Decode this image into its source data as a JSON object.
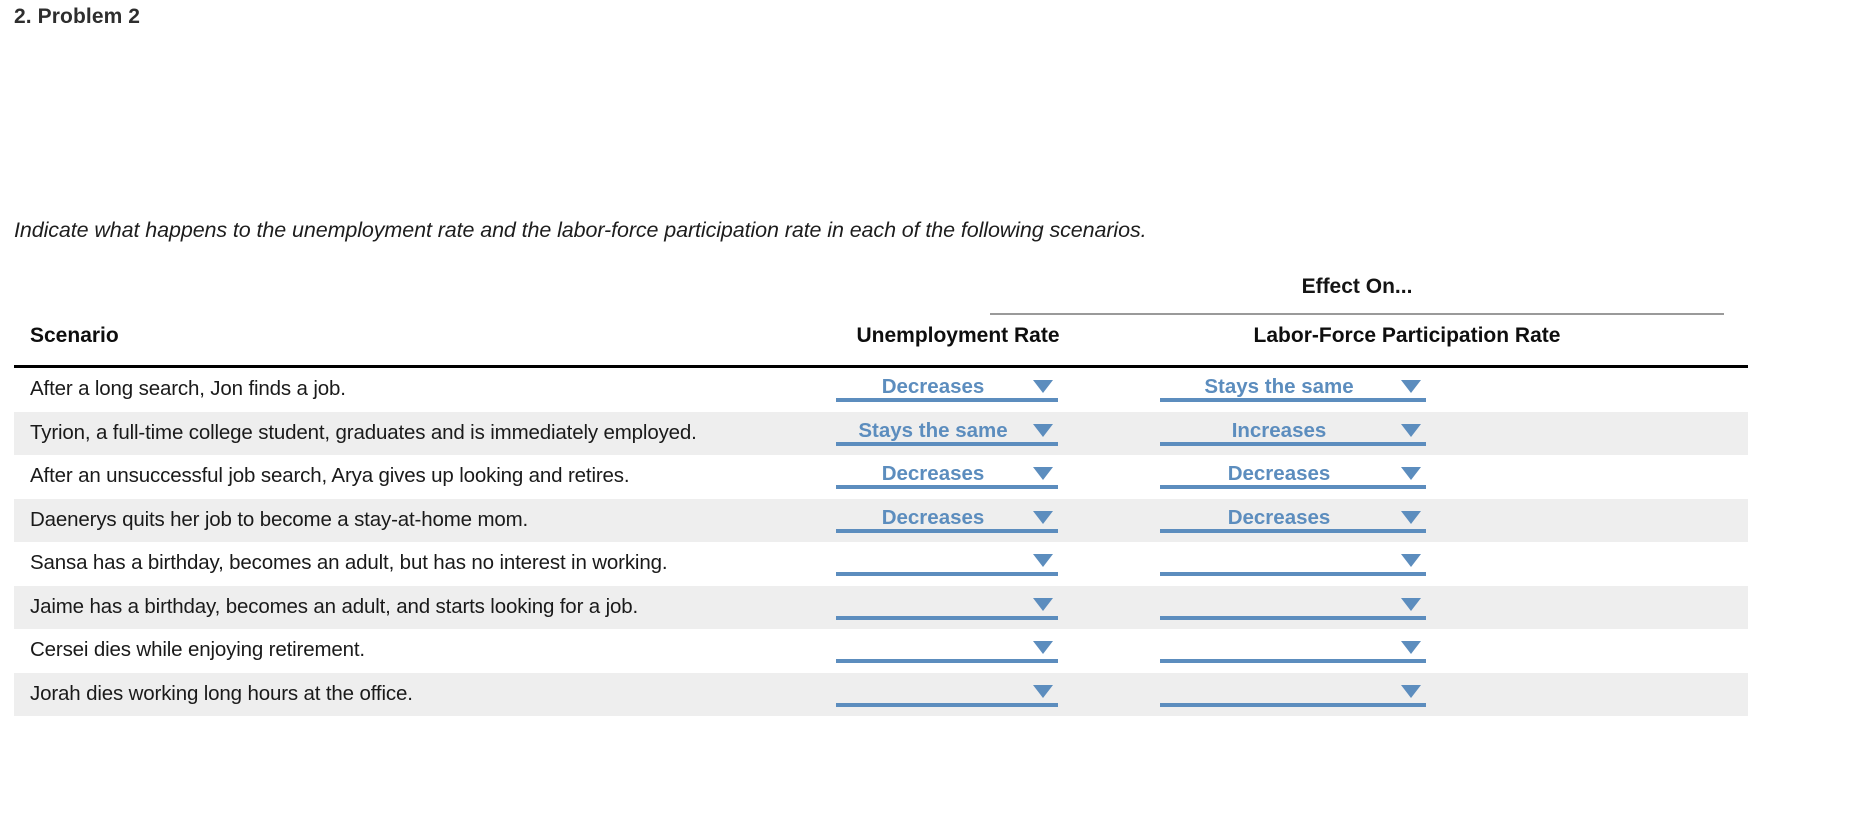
{
  "problem": {
    "heading": "2. Problem 2"
  },
  "instructions": "Indicate what happens to the unemployment rate and the labor-force participation rate in each of the following scenarios.",
  "table": {
    "group_header": "Effect On...",
    "columns": {
      "scenario": "Scenario",
      "unemployment": "Unemployment Rate",
      "lfpr": "Labor-Force Participation Rate"
    },
    "dropdown_icon": "chevron-down-icon",
    "accent_color": "#5c8dbe",
    "stripe_color": "#eeeeee",
    "rows": [
      {
        "scenario": "After a long search, Jon finds a job.",
        "unemployment": "Decreases",
        "lfpr": "Stays the same"
      },
      {
        "scenario": "Tyrion, a full-time college student, graduates and is immediately employed.",
        "unemployment": "Stays the same",
        "lfpr": "Increases"
      },
      {
        "scenario": "After an unsuccessful job search, Arya gives up looking and retires.",
        "unemployment": "Decreases",
        "lfpr": "Decreases"
      },
      {
        "scenario": "Daenerys quits her job to become a stay-at-home mom.",
        "unemployment": "Decreases",
        "lfpr": "Decreases"
      },
      {
        "scenario": "Sansa has a birthday, becomes an adult, but has no interest in working.",
        "unemployment": "",
        "lfpr": ""
      },
      {
        "scenario": "Jaime has a birthday, becomes an adult, and starts looking for a job.",
        "unemployment": "",
        "lfpr": ""
      },
      {
        "scenario": "Cersei dies while enjoying retirement.",
        "unemployment": "",
        "lfpr": ""
      },
      {
        "scenario": "Jorah dies working long hours at the office.",
        "unemployment": "",
        "lfpr": ""
      }
    ]
  }
}
